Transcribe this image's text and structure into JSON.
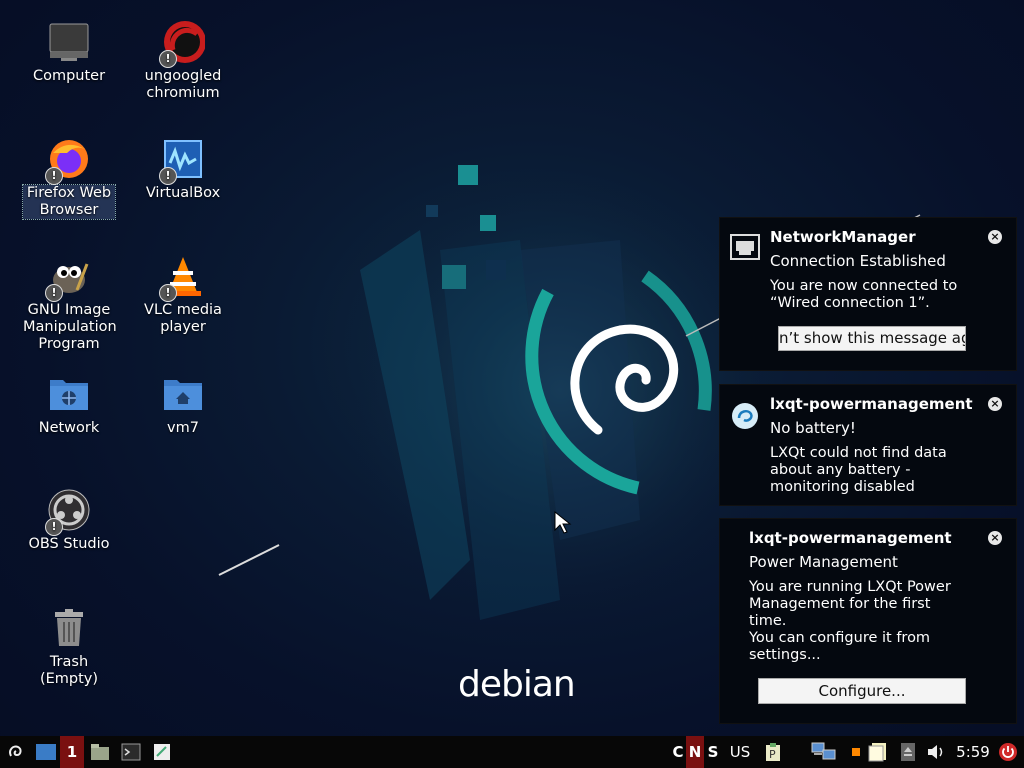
{
  "desktop": {
    "icons": [
      {
        "label": "Computer",
        "icon": "computer-icon"
      },
      {
        "label": "ungoogled chromium",
        "icon": "chromium-icon"
      },
      {
        "label": "Firefox Web Browser",
        "icon": "firefox-icon"
      },
      {
        "label": "VirtualBox",
        "icon": "virtualbox-icon"
      },
      {
        "label": "GNU Image Manipulation Program",
        "icon": "gimp-icon"
      },
      {
        "label": "VLC media player",
        "icon": "vlc-icon"
      },
      {
        "label": "Network",
        "icon": "network-folder-icon"
      },
      {
        "label": "vm7",
        "icon": "home-folder-icon"
      },
      {
        "label": "OBS Studio",
        "icon": "obs-icon"
      },
      {
        "label": "Trash (Empty)",
        "icon": "trash-icon"
      }
    ],
    "badge_symbol": "!",
    "wallpaper_text": "debian"
  },
  "notifications": [
    {
      "app": "NetworkManager",
      "summary": "Connection Established",
      "body": "You are now connected to “Wired connection 1”.",
      "action": "n’t show this message ag",
      "icon": "ethernet-icon"
    },
    {
      "app": "lxqt-powermanagement",
      "summary": "No battery!",
      "body": "LXQt could not find data about any battery - monitoring disabled",
      "icon": "lxqt-logo-icon"
    },
    {
      "app": "lxqt-powermanagement",
      "summary": "Power Management",
      "body_lines": [
        "You are running LXQt Power",
        "Management for the first",
        "time.",
        "You can configure it from",
        "settings..."
      ],
      "action": "Configure..."
    }
  ],
  "taskbar": {
    "desktop_number": "1",
    "kbd_c": "C",
    "kbd_n": "N",
    "kbd_s": "S",
    "layout": "US",
    "clock": "5:59"
  },
  "colors": {
    "accent_teal": "#1aa59a",
    "desktop_indicator": "#7a1010",
    "power_red": "#d02a2a"
  }
}
